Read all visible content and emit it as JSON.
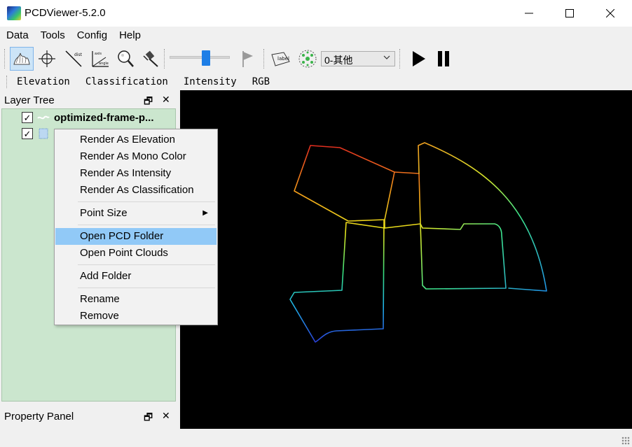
{
  "window": {
    "title": "PCDViewer-5.2.0",
    "controls": {
      "minimize": "—",
      "maximize": "☐",
      "close": "✕"
    }
  },
  "menubar": [
    "Data",
    "Tools",
    "Config",
    "Help"
  ],
  "toolbar": {
    "icons": [
      "elevation-view-icon",
      "crosshair-icon",
      "distance-icon",
      "axis-angle-icon",
      "zoom-icon",
      "pin-icon",
      "flag-icon",
      "label-icon",
      "cluster-icon"
    ],
    "tool_text": {
      "dist": "dist",
      "axis": "axis",
      "angle": "angle",
      "label": "label"
    },
    "slider_value": 0.6,
    "class_select": "0-其他"
  },
  "renderbar": [
    "Elevation",
    "Classification",
    "Intensity",
    "RGB"
  ],
  "layer_tree": {
    "title": "Layer Tree",
    "items": [
      {
        "label": "optimized-frame-p...",
        "checked": true
      },
      {
        "label": "",
        "checked": true
      }
    ]
  },
  "property_panel": {
    "title": "Property Panel"
  },
  "panel_controls": {
    "float": "🗗",
    "close": "✕"
  },
  "context_menu": {
    "items": [
      "Render As Elevation",
      "Render As Mono Color",
      "Render As Intensity",
      "Render As Classification",
      "Point Size",
      "Open PCD Folder",
      "Open Point Clouds",
      "Add Folder",
      "Rename",
      "Remove"
    ],
    "highlighted": "Open PCD Folder",
    "submenu_arrow": "▶"
  },
  "colors": {
    "tree_bg": "#cbe6ce",
    "highlight": "#91c9f7",
    "viewport_bg": "#000000"
  }
}
